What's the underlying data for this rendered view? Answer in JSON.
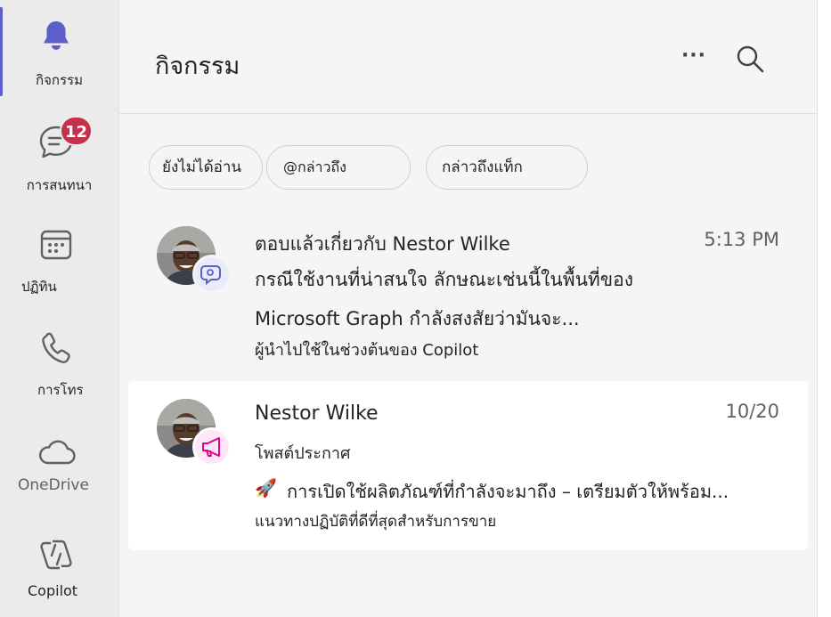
{
  "rail": {
    "activity_label": "กิจกรรม",
    "chat_label": "การสนทนา",
    "chat_badge": "12",
    "calendar_label": "ปฏิทิน",
    "calls_label": "การโทร",
    "onedrive_label": "OneDrive",
    "copilot_label": "Copilot"
  },
  "header": {
    "title": "กิจกรรม",
    "more_label": "···"
  },
  "filters": [
    "ยังไม่ได้อ่าน",
    "@กล่าวถึง",
    "กล่าวถึงแท็ก"
  ],
  "feed": [
    {
      "line1": "ตอบแล้วเกี่ยวกับ Nestor Wilke",
      "time": "5:13 PM",
      "line2": "กรณีใช้งานที่น่าสนใจ ลักษณะเช่นนี้ในพื้นที่ของ",
      "line3": "Microsoft Graph กำลังสงสัยว่ามันจะ...",
      "line4": "ผู้นำไปใช้ในช่วงต้นของ Copilot"
    },
    {
      "line1": "Nestor Wilke",
      "time": "10/20",
      "line2": "โพสต์ประกาศ",
      "line3": "การเปิดใช้ผลิตภัณฑ์ที่กำลังจะมาถึง – เตรียมตัวให้พร้อม...",
      "line3_emoji": "🚀",
      "line4": "แนวทางปฏิบัติที่ดีที่สุดสำหรับการขาย"
    }
  ],
  "colors": {
    "accent": "#5b5fc7",
    "badge": "#c4314b",
    "announcement": "#e3008c"
  }
}
